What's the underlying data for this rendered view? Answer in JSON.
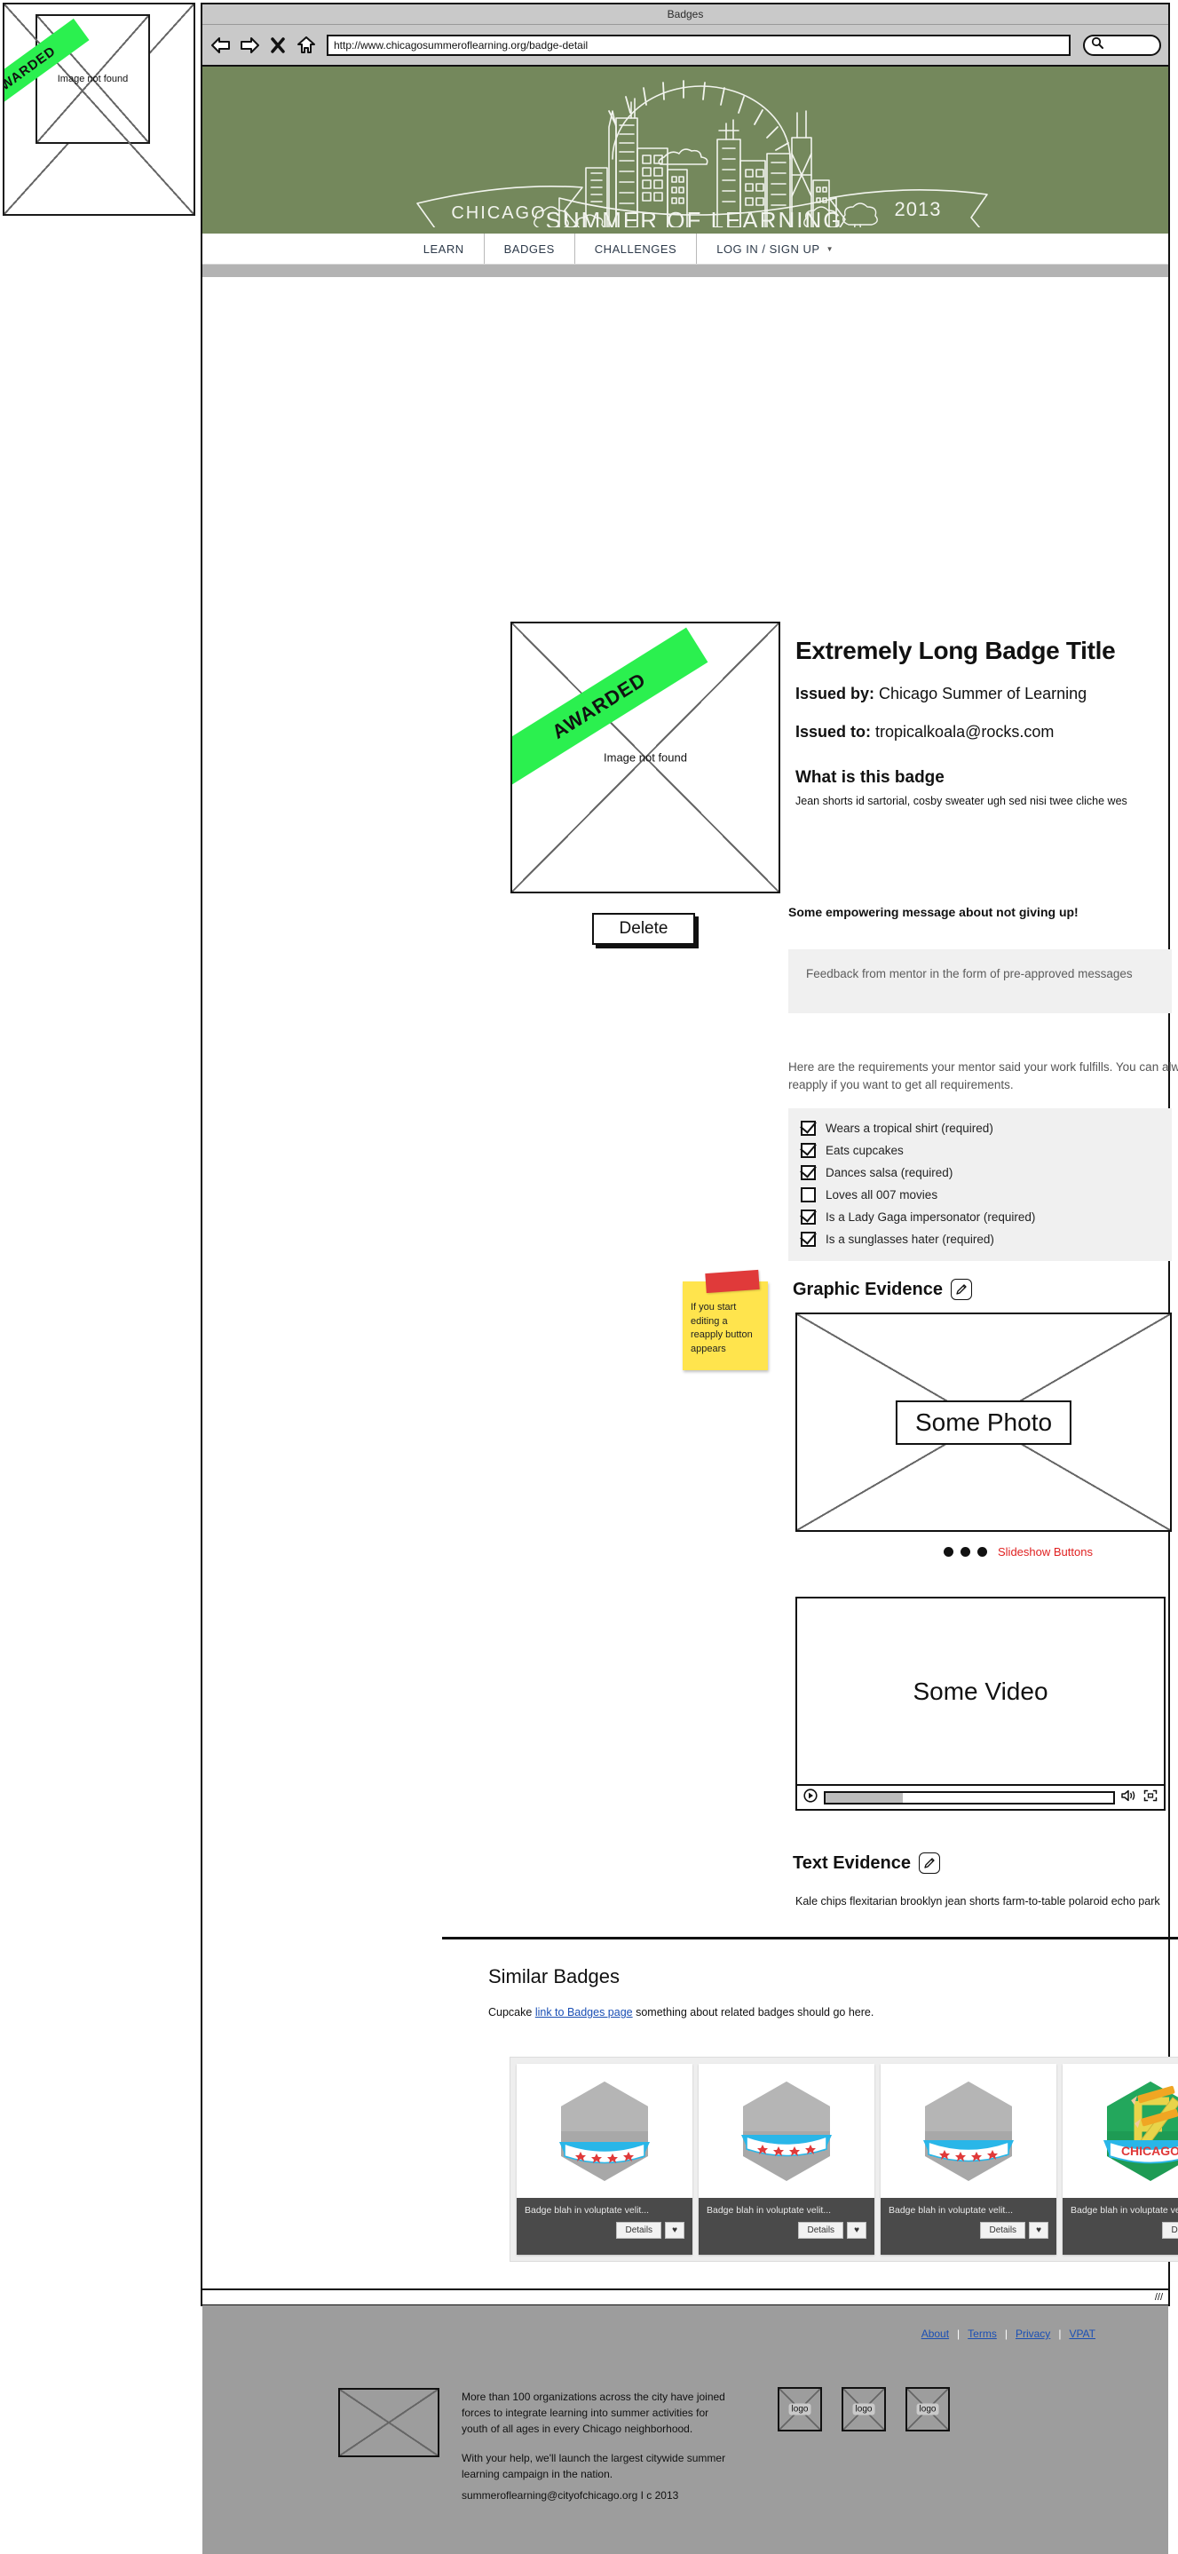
{
  "thumbnail": {
    "label": "Image not found",
    "ribbon": "AWARDED"
  },
  "browser": {
    "window_title": "Badges",
    "url": "http://www.chicagosummeroflearning.org/badge-detail",
    "icons": {
      "back": "back-arrow-icon",
      "forward": "forward-arrow-icon",
      "stop": "close-x-icon",
      "home": "home-icon",
      "search": "search-icon"
    }
  },
  "site_header": {
    "banner_ribbon_left": "CHICAGO",
    "banner_center": "SUMMER OF LEARNING",
    "banner_ribbon_right": "2013",
    "background_color": "#74885c"
  },
  "nav": {
    "items": [
      {
        "label": "LEARN",
        "has_caret": false
      },
      {
        "label": "BADGES",
        "has_caret": false
      },
      {
        "label": "CHALLENGES",
        "has_caret": false
      },
      {
        "label": "LOG IN / SIGN UP",
        "has_caret": true
      }
    ]
  },
  "badge": {
    "image_label": "Image not found",
    "ribbon": "AWARDED",
    "delete_label": "Delete",
    "title": "Extremely Long Badge Title",
    "issued_by_label": "Issued by:",
    "issued_by_value": "Chicago Summer of Learning",
    "issued_to_label": "Issued to:",
    "issued_to_value": "tropicalkoala@rocks.com",
    "what_heading": "What is this badge",
    "what_body": "Jean shorts id sartorial, cosby sweater ugh sed nisi twee cliche wes",
    "empowering_message": "Some empowering message about not giving up!",
    "feedback": "Feedback from mentor in the form of pre-approved messages",
    "requirements_intro": "Here are the requirements your mentor said your work fulfills. You can always reapply if you want to get all requirements.",
    "requirements": [
      {
        "label": "Wears a tropical shirt (required)",
        "checked": true
      },
      {
        "label": "Eats cupcakes",
        "checked": true
      },
      {
        "label": "Dances salsa  (required)",
        "checked": true
      },
      {
        "label": "Loves all 007 movies",
        "checked": false
      },
      {
        "label": "Is a Lady Gaga impersonator (required)",
        "checked": true
      },
      {
        "label": "Is a sunglasses hater (required)",
        "checked": true
      }
    ]
  },
  "sticky_note": {
    "text": "If you start editing a reapply button appears",
    "color": "#ffe44d",
    "tape_color": "#e03a3a"
  },
  "graphic_evidence": {
    "heading": "Graphic Evidence",
    "edit_icon": "pencil-icon",
    "photo_placeholder": "Some Photo",
    "slideshow_label": "Slideshow Buttons",
    "slideshow_label_color": "#e02020",
    "dot_count": 3,
    "video_placeholder": "Some Video",
    "video_progress_percent": 27
  },
  "text_evidence": {
    "heading": "Text Evidence",
    "edit_icon": "pencil-icon",
    "body": "Kale chips flexitarian brooklyn jean shorts farm-to-table polaroid echo park"
  },
  "similar_badges": {
    "heading": "Similar Badges",
    "subtitle_before": "Cupcake ",
    "subtitle_link": "link to Badges page",
    "subtitle_after": " something about related badges should go here.",
    "cards": [
      {
        "title": "Badge blah in voluptate velit...",
        "details_label": "Details",
        "fav_label": "♥",
        "style": "gray"
      },
      {
        "title": "Badge blah in voluptate velit...",
        "details_label": "Details",
        "fav_label": "♥",
        "style": "gray"
      },
      {
        "title": "Badge blah in voluptate velit...",
        "details_label": "Details",
        "fav_label": "♥",
        "style": "gray"
      },
      {
        "title": "Badge blah in voluptate velit...",
        "details_label": "Details",
        "fav_label": "♥",
        "style": "chicago"
      }
    ]
  },
  "footer": {
    "links": [
      "About",
      "Terms",
      "Privacy",
      "VPAT"
    ],
    "paragraph1": "More than 100 organizations across the city have joined forces to integrate learning into summer activities for youth of all ages in every Chicago neighborhood.",
    "paragraph2": "With your help, we'll launch the largest citywide summer learning campaign in the nation.",
    "contact": "summeroflearning@cityofchicago.org I c 2013",
    "logos": [
      "logo",
      "logo",
      "logo"
    ],
    "background_color": "#9d9d9d"
  }
}
